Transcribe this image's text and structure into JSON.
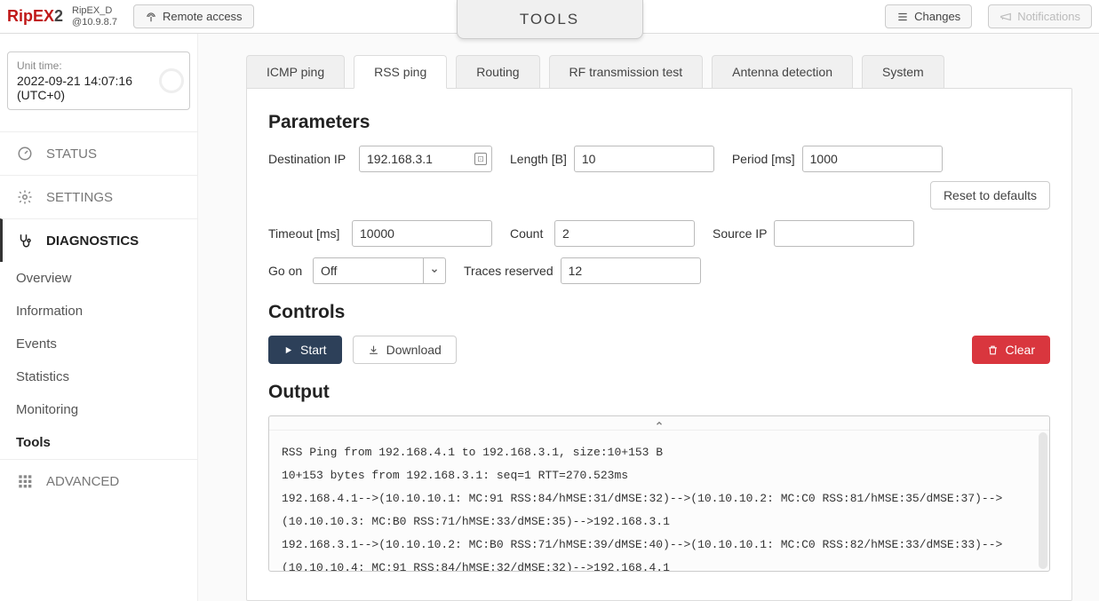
{
  "header": {
    "logo_main": "RipEX",
    "logo_suffix": "2",
    "device_name": "RipEX_D",
    "device_ip": "@10.9.8.7",
    "remote_access_label": "Remote access",
    "page_title": "TOOLS",
    "changes_label": "Changes",
    "notifications_label": "Notifications"
  },
  "time": {
    "label": "Unit time:",
    "value": "2022-09-21 14:07:16 (UTC+0)"
  },
  "nav": {
    "status": "STATUS",
    "settings": "SETTINGS",
    "diagnostics": "DIAGNOSTICS",
    "overview": "Overview",
    "information": "Information",
    "events": "Events",
    "statistics": "Statistics",
    "monitoring": "Monitoring",
    "tools": "Tools",
    "advanced": "ADVANCED"
  },
  "tabs": {
    "icmp_ping": "ICMP ping",
    "rss_ping": "RSS ping",
    "routing": "Routing",
    "rf_test": "RF transmission test",
    "antenna": "Antenna detection",
    "system": "System"
  },
  "sections": {
    "parameters": "Parameters",
    "controls": "Controls",
    "output": "Output"
  },
  "params": {
    "dest_ip_label": "Destination IP",
    "dest_ip": "192.168.3.1",
    "length_label": "Length [B]",
    "length": "10",
    "period_label": "Period [ms]",
    "period": "1000",
    "timeout_label": "Timeout [ms]",
    "timeout": "10000",
    "count_label": "Count",
    "count": "2",
    "source_ip_label": "Source IP",
    "source_ip": "",
    "go_on_label": "Go on",
    "go_on": "Off",
    "traces_label": "Traces reserved",
    "traces": "12",
    "reset_label": "Reset to defaults"
  },
  "controls": {
    "start": "Start",
    "download": "Download",
    "clear": "Clear"
  },
  "output_text": "RSS Ping from 192.168.4.1 to 192.168.3.1, size:10+153 B\n10+153 bytes from 192.168.3.1: seq=1 RTT=270.523ms\n192.168.4.1-->(10.10.10.1: MC:91 RSS:84/hMSE:31/dMSE:32)-->(10.10.10.2: MC:C0 RSS:81/hMSE:35/dMSE:37)-->(10.10.10.3: MC:B0 RSS:71/hMSE:33/dMSE:35)-->192.168.3.1\n192.168.3.1-->(10.10.10.2: MC:B0 RSS:71/hMSE:39/dMSE:40)-->(10.10.10.1: MC:C0 RSS:82/hMSE:33/dMSE:33)-->(10.10.10.4: MC:91 RSS:84/hMSE:32/dMSE:32)-->192.168.4.1"
}
